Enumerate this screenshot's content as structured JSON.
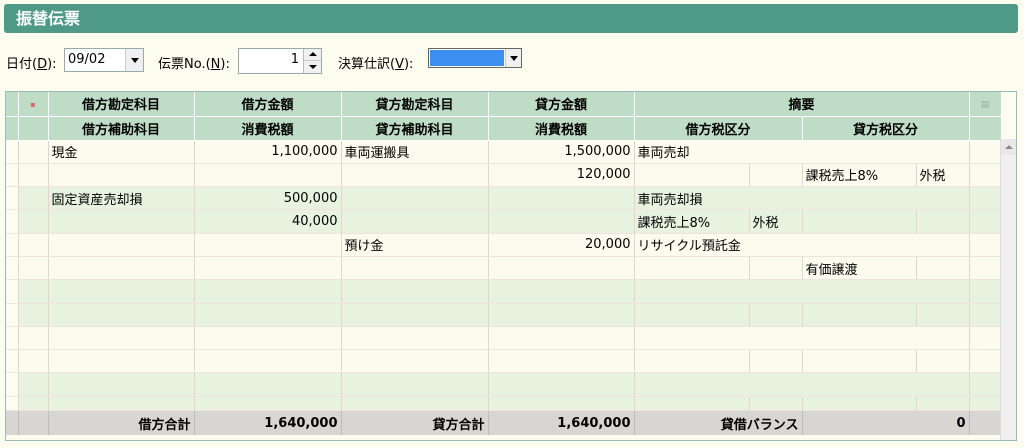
{
  "window": {
    "title": "振替伝票"
  },
  "toolbar": {
    "date_label": "日付(",
    "date_key": "D",
    "date_label_end": "):",
    "date_value": "09/02",
    "voucher_label": "伝票No.(",
    "voucher_key": "N",
    "voucher_label_end": "):",
    "voucher_value": "1",
    "settle_label": "決算仕訳(",
    "settle_key": "V",
    "settle_label_end": "):",
    "settle_color": "#3c8ff0"
  },
  "header": {
    "row1": [
      "借方勘定科目",
      "借方金額",
      "貸方勘定科目",
      "貸方金額",
      "摘要"
    ],
    "row2": [
      "借方補助科目",
      "消費税額",
      "貸方補助科目",
      "消費税額",
      "借方税区分",
      "貸方税区分"
    ]
  },
  "entries": [
    {
      "line1": {
        "debit_account": "現金",
        "debit_amount": "1,100,000",
        "credit_account": "車両運搬具",
        "credit_amount": "1,500,000",
        "memo": "車両売却"
      },
      "line2": {
        "debit_sub": "",
        "debit_tax": "",
        "credit_sub": "",
        "credit_tax": "120,000",
        "debit_taxcat": "",
        "debit_taxtype": "",
        "credit_taxcat": "課税売上8%",
        "credit_taxtype": "外税"
      }
    },
    {
      "line1": {
        "debit_account": "固定資産売却損",
        "debit_amount": "500,000",
        "credit_account": "",
        "credit_amount": "",
        "memo": "車両売却損"
      },
      "line2": {
        "debit_sub": "",
        "debit_tax": "40,000",
        "credit_sub": "",
        "credit_tax": "",
        "debit_taxcat": "課税売上8%",
        "debit_taxtype": "外税",
        "credit_taxcat": "",
        "credit_taxtype": ""
      }
    },
    {
      "line1": {
        "debit_account": "",
        "debit_amount": "",
        "credit_account": "預け金",
        "credit_amount": "20,000",
        "memo": "リサイクル預託金"
      },
      "line2": {
        "debit_sub": "",
        "debit_tax": "",
        "credit_sub": "",
        "credit_tax": "",
        "debit_taxcat": "",
        "debit_taxtype": "",
        "credit_taxcat": "有価譲渡",
        "credit_taxtype": ""
      }
    }
  ],
  "totals": {
    "debit_label": "借方合計",
    "debit_total": "1,640,000",
    "credit_label": "貸方合計",
    "credit_total": "1,640,000",
    "balance_label": "貸借バランス",
    "balance_value": "0"
  },
  "icons": {
    "corner": "row-marker-icon",
    "header_right": "document-icon"
  }
}
